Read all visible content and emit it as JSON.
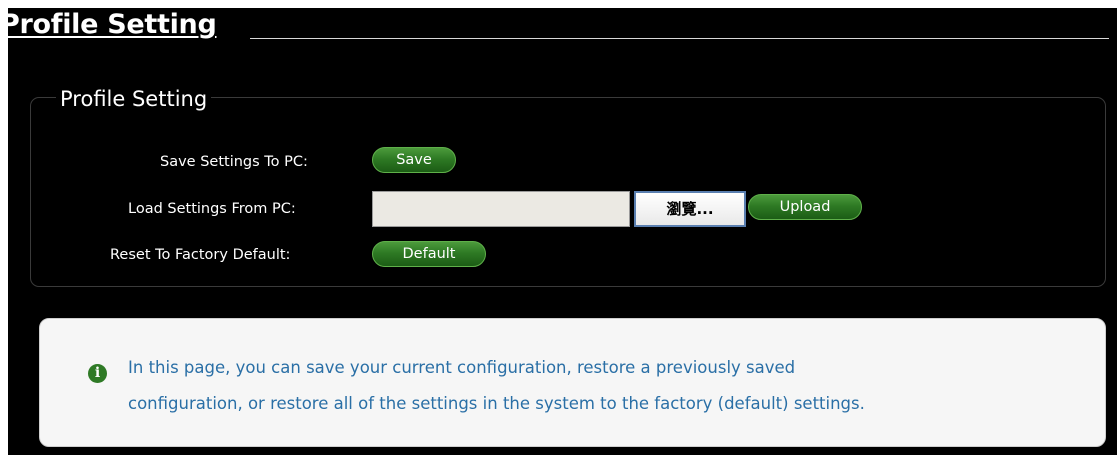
{
  "page": {
    "title": "Profile Setting"
  },
  "section": {
    "legend": "Profile Setting",
    "rows": {
      "save": {
        "label": "Save Settings To PC:",
        "button": "Save"
      },
      "load": {
        "label": "Load Settings From PC:",
        "file_value": "",
        "browse_label": "瀏覽...",
        "button": "Upload"
      },
      "reset": {
        "label": "Reset To Factory Default:",
        "button": "Default"
      }
    }
  },
  "info": {
    "icon": "info-icon",
    "glyph": "i",
    "line1": "In this page, you can save your current configuration, restore a previously saved",
    "line2": "configuration, or restore all of the settings in the system to the factory (default) settings."
  },
  "colors": {
    "background": "#000000",
    "button_green": "#2e7a24",
    "info_text": "#2a6fa6",
    "info_background": "#f6f6f6"
  }
}
